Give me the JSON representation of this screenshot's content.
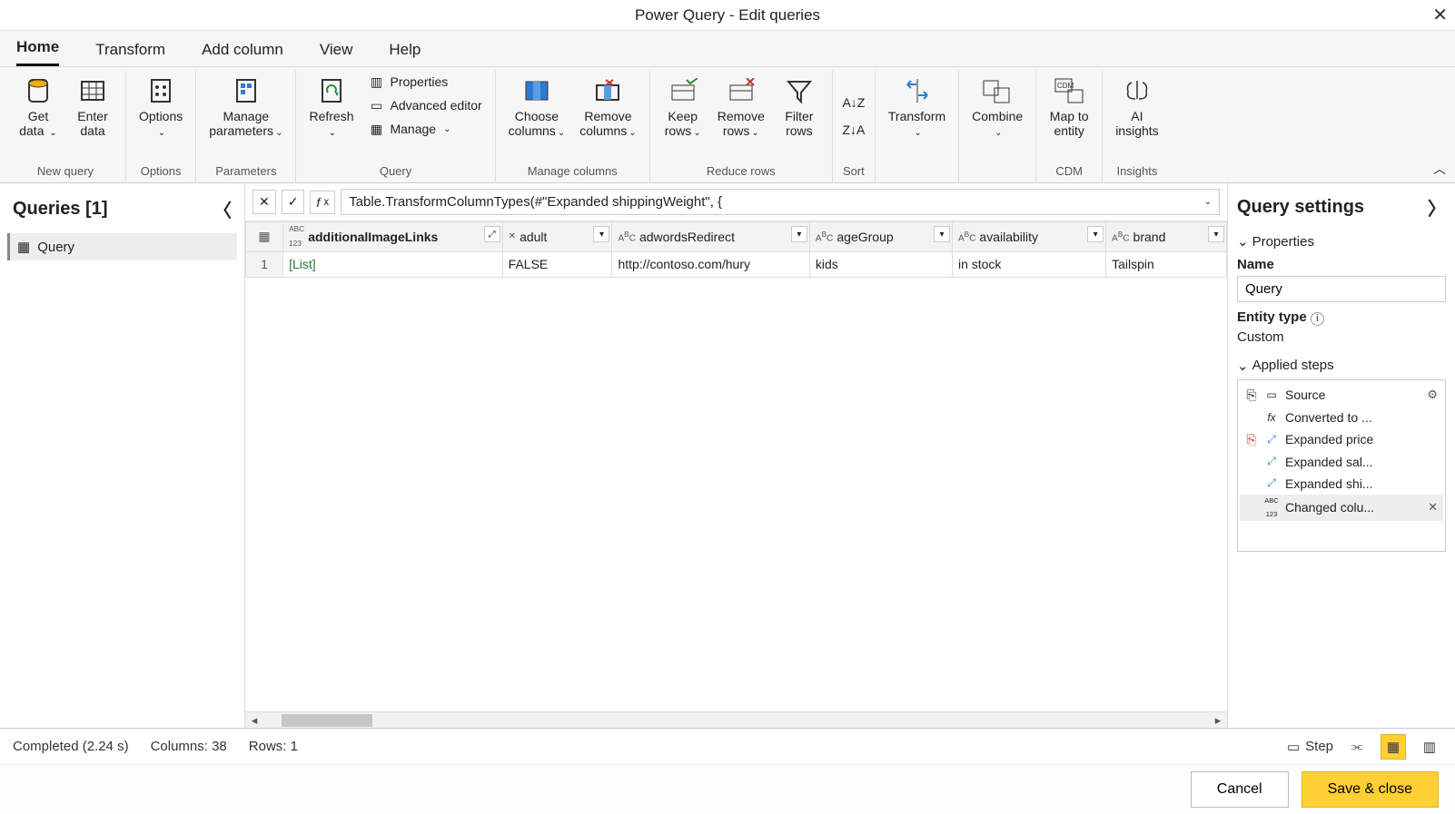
{
  "window": {
    "title": "Power Query - Edit queries"
  },
  "tabs": {
    "home": "Home",
    "transform": "Transform",
    "addcol": "Add column",
    "view": "View",
    "help": "Help"
  },
  "ribbon": {
    "get_data": "Get\ndata",
    "enter_data": "Enter\ndata",
    "options": "Options",
    "manage_parameters": "Manage\nparameters",
    "refresh": "Refresh",
    "properties": "Properties",
    "advanced_editor": "Advanced editor",
    "manage": "Manage",
    "choose_columns": "Choose\ncolumns",
    "remove_columns": "Remove\ncolumns",
    "keep_rows": "Keep\nrows",
    "remove_rows": "Remove\nrows",
    "filter_rows": "Filter\nrows",
    "sort": "",
    "transform": "Transform",
    "combine": "Combine",
    "map_to_entity": "Map to\nentity",
    "ai_insights": "AI\ninsights",
    "groups": {
      "new_query": "New query",
      "options": "Options",
      "parameters": "Parameters",
      "query": "Query",
      "manage_columns": "Manage columns",
      "reduce_rows": "Reduce rows",
      "sort": "Sort",
      "cdm": "CDM",
      "insights": "Insights"
    }
  },
  "queries": {
    "header": "Queries [1]",
    "item": "Query"
  },
  "formula": {
    "text": "Table.TransformColumnTypes(#\"Expanded shippingWeight\", {"
  },
  "columns": [
    {
      "name": "additionalImageLinks",
      "type": "abc123",
      "highlight": true,
      "expand": true
    },
    {
      "name": "adult",
      "type": "xred"
    },
    {
      "name": "adwordsRedirect",
      "type": "abc"
    },
    {
      "name": "ageGroup",
      "type": "abc"
    },
    {
      "name": "availability",
      "type": "abc"
    },
    {
      "name": "brand",
      "type": "abc"
    }
  ],
  "row": {
    "n": "1",
    "cells": [
      "[List]",
      "FALSE",
      "http://contoso.com/hury",
      "kids",
      "in stock",
      "Tailspin"
    ]
  },
  "settings": {
    "header": "Query settings",
    "properties": "Properties",
    "name_label": "Name",
    "name_value": "Query",
    "entity_type_label": "Entity type",
    "entity_type_value": "Custom",
    "applied_steps": "Applied steps",
    "steps": {
      "source": "Source",
      "converted": "Converted to ...",
      "exp_price": "Expanded price",
      "exp_sal": "Expanded sal...",
      "exp_shi": "Expanded shi...",
      "changed": "Changed colu..."
    }
  },
  "status": {
    "completed": "Completed (2.24 s)",
    "cols": "Columns: 38",
    "rows": "Rows: 1",
    "step": "Step"
  },
  "footer": {
    "cancel": "Cancel",
    "save": "Save & close"
  }
}
